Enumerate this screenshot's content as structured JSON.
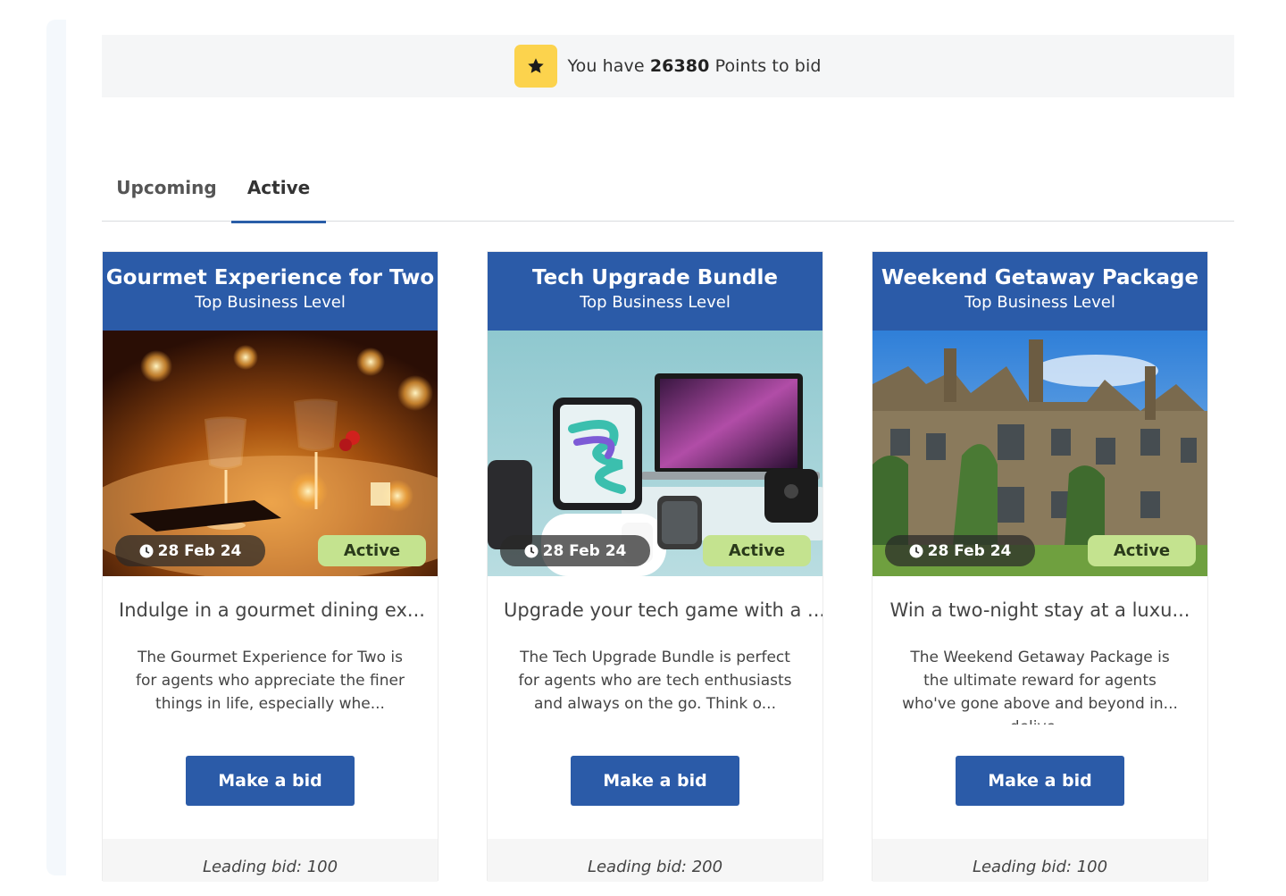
{
  "points": {
    "prefix": "You have",
    "value": "26380",
    "suffix": "Points to bid",
    "icon": "star-icon",
    "icon_bg": "#fcd34d"
  },
  "tabs": [
    {
      "label": "Upcoming",
      "selected": false
    },
    {
      "label": "Active",
      "selected": true
    }
  ],
  "accent_color": "#2b5ba8",
  "cards": [
    {
      "title": "Gourmet Experience for Two",
      "level": "Top Business Level",
      "image": "restaurant-table-photo",
      "date": "28 Feb 24",
      "status": "Active",
      "summary": "Indulge in a gourmet dining ex...",
      "description": "The Gourmet Experience for Two is for agents who appreciate the finer things in life, especially whe...",
      "button": "Make a bid",
      "leading_bid": "Leading bid: 100"
    },
    {
      "title": "Tech Upgrade Bundle",
      "level": "Top Business Level",
      "image": "apple-devices-photo",
      "date": "28 Feb 24",
      "status": "Active",
      "summary": "Upgrade your tech game with a ...",
      "description": "The Tech Upgrade Bundle is perfect for agents who are tech enthusiasts and always on the go. Think o...",
      "button": "Make a bid",
      "leading_bid": "Leading bid: 200"
    },
    {
      "title": "Weekend Getaway Package",
      "level": "Top Business Level",
      "image": "manor-house-photo",
      "date": "28 Feb 24",
      "status": "Active",
      "summary": "Win a two-night stay at a luxu...",
      "description": "The Weekend Getaway Package is the ultimate reward for agents who've gone above and beyond in... delive...",
      "button": "Make a bid",
      "leading_bid": "Leading bid: 100"
    }
  ]
}
